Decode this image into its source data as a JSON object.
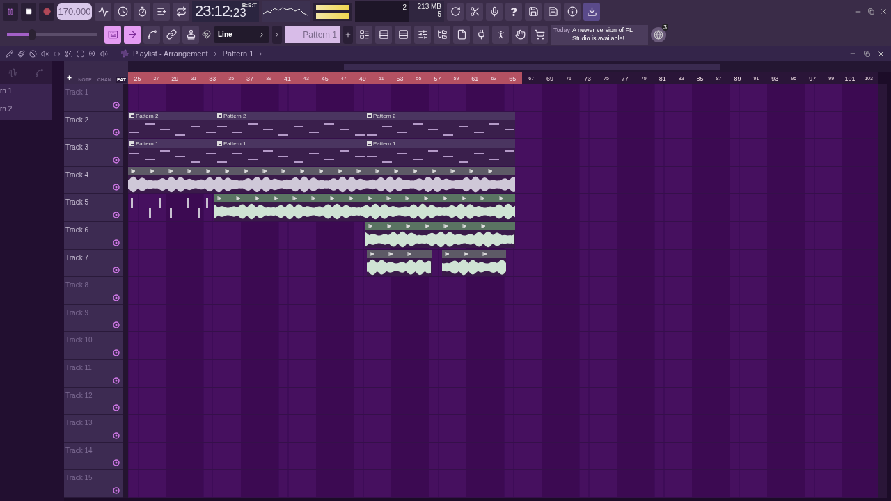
{
  "transport": {
    "playing": true,
    "recording": false,
    "tempo": "170.000"
  },
  "time": {
    "main": "23:12",
    "sub": ":23",
    "unit": "B:S:T"
  },
  "monitor": {
    "cpu": "2",
    "memory": "213 MB",
    "polyphony": "5"
  },
  "master_slider": {
    "level": 0.28
  },
  "mode_buttons": [
    {
      "on": true
    },
    {
      "on": true
    },
    {
      "on": false
    },
    {
      "on": false
    },
    {
      "on": false
    }
  ],
  "snap": {
    "value": "Line"
  },
  "pattern_selector": {
    "value": "Pattern 1"
  },
  "hint": {
    "day": "Today",
    "text": "A newer version of FL Studio is available!",
    "badge": "3"
  },
  "channel_rack_items": [
    {
      "label": "rn 1"
    },
    {
      "label": "rn 2"
    }
  ],
  "playlist": {
    "title": "Playlist - Arrangement",
    "breadcrumb": "Pattern 1",
    "header_tabs": [
      {
        "label": "NOTE",
        "selected": false
      },
      {
        "label": "CHAN",
        "selected": false
      },
      {
        "label": "PAT",
        "selected": true
      }
    ],
    "add_button": "+",
    "ruler": [
      {
        "label": "25",
        "in_loop": true
      },
      {
        "label": "27",
        "in_loop": true
      },
      {
        "label": "29",
        "in_loop": true
      },
      {
        "label": "31",
        "in_loop": true
      },
      {
        "label": "33",
        "in_loop": true
      },
      {
        "label": "35",
        "in_loop": true
      },
      {
        "label": "37",
        "in_loop": true
      },
      {
        "label": "39",
        "in_loop": true
      },
      {
        "label": "41",
        "in_loop": true
      },
      {
        "label": "43",
        "in_loop": true
      },
      {
        "label": "45",
        "in_loop": true
      },
      {
        "label": "47",
        "in_loop": true
      },
      {
        "label": "49",
        "in_loop": true
      },
      {
        "label": "51",
        "in_loop": true
      },
      {
        "label": "53",
        "in_loop": true
      },
      {
        "label": "55",
        "in_loop": true
      },
      {
        "label": "57",
        "in_loop": true
      },
      {
        "label": "59",
        "in_loop": true
      },
      {
        "label": "61",
        "in_loop": true
      },
      {
        "label": "63",
        "in_loop": true
      },
      {
        "label": "65",
        "in_loop": true
      },
      {
        "label": "67",
        "in_loop": false
      },
      {
        "label": "69",
        "in_loop": false
      },
      {
        "label": "71",
        "in_loop": false
      },
      {
        "label": "73",
        "in_loop": false
      },
      {
        "label": "75",
        "in_loop": false
      },
      {
        "label": "77",
        "in_loop": false
      },
      {
        "label": "79",
        "in_loop": false
      },
      {
        "label": "81",
        "in_loop": false
      },
      {
        "label": "83",
        "in_loop": false
      },
      {
        "label": "85",
        "in_loop": false
      },
      {
        "label": "87",
        "in_loop": false
      },
      {
        "label": "89",
        "in_loop": false
      },
      {
        "label": "91",
        "in_loop": false
      },
      {
        "label": "93",
        "in_loop": false
      },
      {
        "label": "95",
        "in_loop": false
      },
      {
        "label": "97",
        "in_loop": false
      },
      {
        "label": "99",
        "in_loop": false
      },
      {
        "label": "101",
        "in_loop": false
      },
      {
        "label": "103",
        "in_loop": false
      }
    ],
    "tracks": [
      {
        "name": "Track 1",
        "active": false
      },
      {
        "name": "Track 2",
        "active": true,
        "clips": [
          {
            "kind": "pattern",
            "label": "Pattern 2"
          },
          {
            "kind": "pattern",
            "label": "Pattern 2"
          },
          {
            "kind": "pattern",
            "label": "Pattern 2"
          }
        ]
      },
      {
        "name": "Track 3",
        "active": true,
        "clips": [
          {
            "kind": "pattern",
            "label": "Pattern 1"
          },
          {
            "kind": "pattern",
            "label": "Pattern 1"
          },
          {
            "kind": "pattern",
            "label": "Pattern 1"
          }
        ]
      },
      {
        "name": "Track 4",
        "active": true,
        "clips": [
          {
            "kind": "audio",
            "color": "#5d5a66"
          }
        ]
      },
      {
        "name": "Track 5",
        "active": true,
        "clips": [
          {
            "kind": "slices"
          },
          {
            "kind": "audio",
            "color": "#5a7462"
          }
        ]
      },
      {
        "name": "Track 6",
        "active": true,
        "clips": [
          {
            "kind": "audio",
            "color": "#5a7462"
          }
        ]
      },
      {
        "name": "Track 7",
        "active": true,
        "clips": [
          {
            "kind": "audio",
            "color": "#5d5a66"
          },
          {
            "kind": "audio",
            "color": "#5d5a66"
          }
        ]
      },
      {
        "name": "Track 8",
        "active": false
      },
      {
        "name": "Track 9",
        "active": false
      },
      {
        "name": "Track 10",
        "active": false
      },
      {
        "name": "Track 11",
        "active": false
      },
      {
        "name": "Track 12",
        "active": false
      },
      {
        "name": "Track 13",
        "active": false
      },
      {
        "name": "Track 14",
        "active": false
      },
      {
        "name": "Track 15",
        "active": false
      }
    ]
  }
}
